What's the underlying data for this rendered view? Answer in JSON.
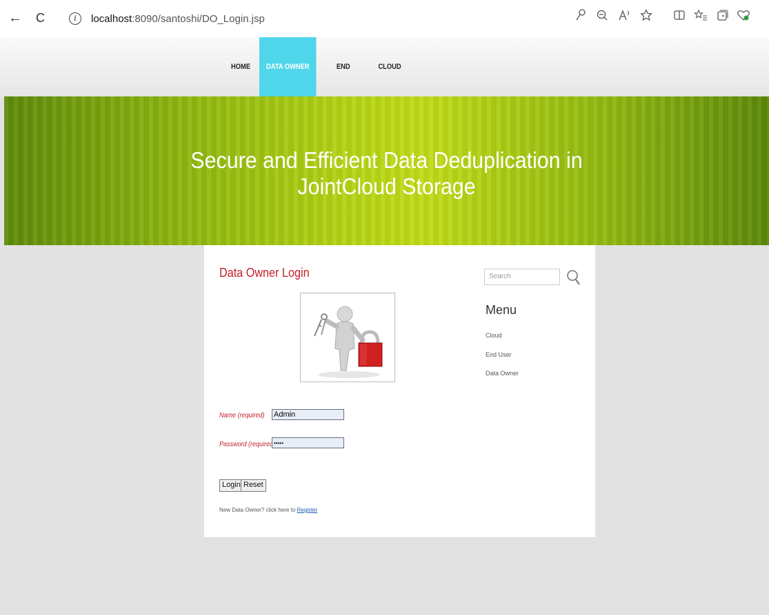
{
  "browser": {
    "back_icon": "←",
    "refresh_icon": "C",
    "info_icon": "i",
    "url_host": "localhost",
    "url_path": ":8090/santoshi/DO_Login.jsp"
  },
  "nav": {
    "items": [
      {
        "label": "HOME"
      },
      {
        "label": "DATA OWNER"
      },
      {
        "label": "END USER"
      },
      {
        "label": "CLOUD"
      }
    ],
    "active_color": "#4fd6ea"
  },
  "banner": {
    "title_line1": "Secure and Efficient Data Deduplication in",
    "title_line2": "JointCloud Storage"
  },
  "login": {
    "title": "Data Owner Login",
    "name_label": "Name (required)",
    "name_value": "Admin",
    "password_label": "Password (required)",
    "password_value": "•••••",
    "login_button": "Login",
    "reset_button": "Reset",
    "register_prompt": "New Data Owner? click here to",
    "register_link": "Register"
  },
  "sidebar": {
    "search_placeholder": "Search",
    "menu_title": "Menu",
    "menu_items": [
      "Cloud",
      "End User",
      "Data Owner"
    ]
  },
  "colors": {
    "accent_red": "#c0202a",
    "banner_green": "#b4d313"
  }
}
